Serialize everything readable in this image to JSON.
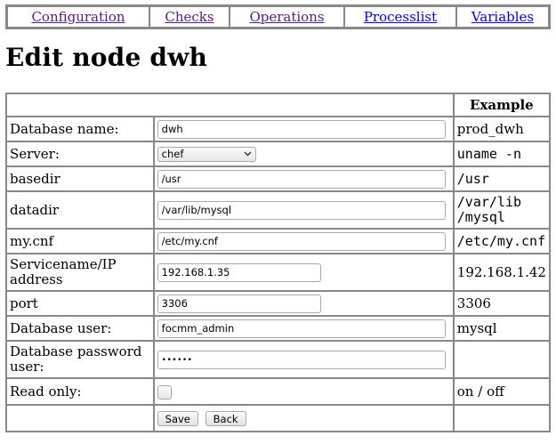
{
  "nav": {
    "items": [
      "Configuration",
      "Checks",
      "Operations",
      "Processlist",
      "Variables"
    ]
  },
  "page_title": "Edit node dwh",
  "table": {
    "header_example": "Example",
    "rows": [
      {
        "label": "Database name:",
        "value": "dwh",
        "example": "prod_dwh"
      },
      {
        "label": "Server:",
        "value": "chef",
        "example": "uname -n"
      },
      {
        "label": "basedir",
        "value": "/usr",
        "example": "/usr"
      },
      {
        "label": "datadir",
        "value": "/var/lib/mysql",
        "example_line1": "/var/lib",
        "example_line2": "/mysql"
      },
      {
        "label": "my.cnf",
        "value": "/etc/my.cnf",
        "example": "/etc/my.cnf"
      },
      {
        "label_line1": "Servicename/IP",
        "label_line2": "address",
        "value": "192.168.1.35",
        "example": "192.168.1.42"
      },
      {
        "label": "port",
        "value": "3306",
        "example": "3306"
      },
      {
        "label": "Database user:",
        "value": "focmm_admin",
        "example": "mysql"
      },
      {
        "label_line1": "Database password",
        "label_line2": "user:",
        "value": "••••••",
        "example": ""
      },
      {
        "label": "Read only:",
        "checked": false,
        "example": "on / off"
      }
    ],
    "save_label": "Save",
    "back_label": "Back"
  }
}
